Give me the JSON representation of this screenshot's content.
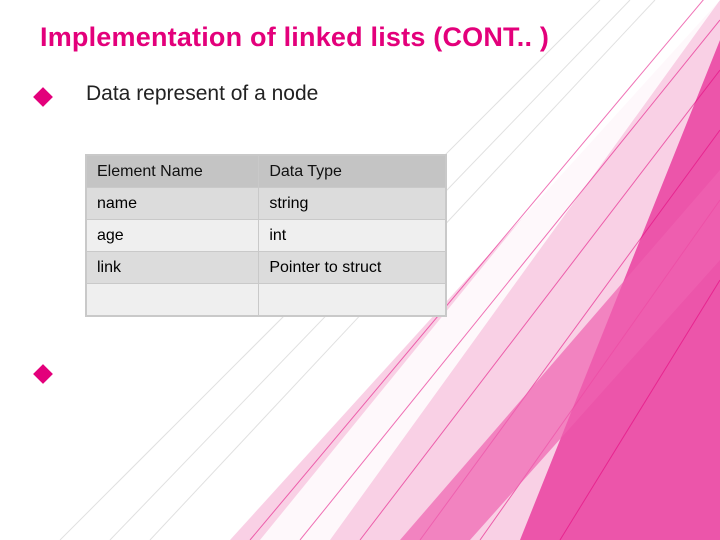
{
  "title": "Implementation of linked lists (CONT.. )",
  "subhead": "Data represent of a node",
  "chart_data": {
    "type": "table",
    "headers": [
      "Element Name",
      "Data Type"
    ],
    "rows": [
      [
        "name",
        "string"
      ],
      [
        "age",
        "int"
      ],
      [
        "link",
        "Pointer to struct"
      ],
      [
        "",
        ""
      ]
    ]
  },
  "colors": {
    "accent": "#e3007b",
    "header_bg": "#c4c4c4"
  }
}
